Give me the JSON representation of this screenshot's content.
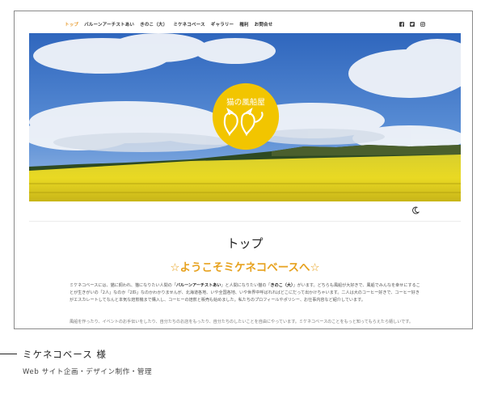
{
  "nav": {
    "items": [
      {
        "label": "トップ",
        "active": true
      },
      {
        "label": "バルーンアーチストあい"
      },
      {
        "label": "きのこ（大）"
      },
      {
        "label": "ミケネコベース"
      },
      {
        "label": "ギャラリー"
      },
      {
        "label": "権利"
      },
      {
        "label": "お問合せ"
      }
    ],
    "social": [
      "facebook-icon",
      "twitter-icon",
      "instagram-icon"
    ]
  },
  "hero": {
    "logo_text": "猫の風船屋",
    "colors": {
      "sky": "#3f78c8",
      "field": "#e6d51f",
      "logo": "#f2c500"
    }
  },
  "page": {
    "title": "トップ",
    "welcome": "☆ようこそミケネコベースへ☆",
    "intro_parts": [
      "ミケネコベースには、猫に飼われ、猫になりたい人間の「",
      "バルーンアーチストあい",
      "」と人間になりたい猫の「",
      "きのこ（大）",
      "」がいます。どちらも風船が大好きで、風船でみんなを幸せにすることが生きがいの「2人」なのか「2匹」なのかわかりませんが、北海道各地、いや全国各地、いや世界中呼ばれればどこにだって出かけちゃいます。二人は大のコーヒー好きで、コーヒー好きがエスカレートしてなんと本気な焙煎機まで購入し、コーヒーの焙煎と販売も始めました。私たちのプロフィールやポリシー、お仕事内容など紹介しています。"
    ],
    "intro2": "風船を作ったり、イベントのお手伝いをしたり、自分たちのお店をもったり、自分たちのしたいことを自由にやっています。ミケネコベースのことをもっと知ってもらえたら嬉しいです。"
  },
  "caption": {
    "title": "ミケネコベース 様",
    "subtitle": "Web サイト企画・デザイン制作・管理"
  }
}
